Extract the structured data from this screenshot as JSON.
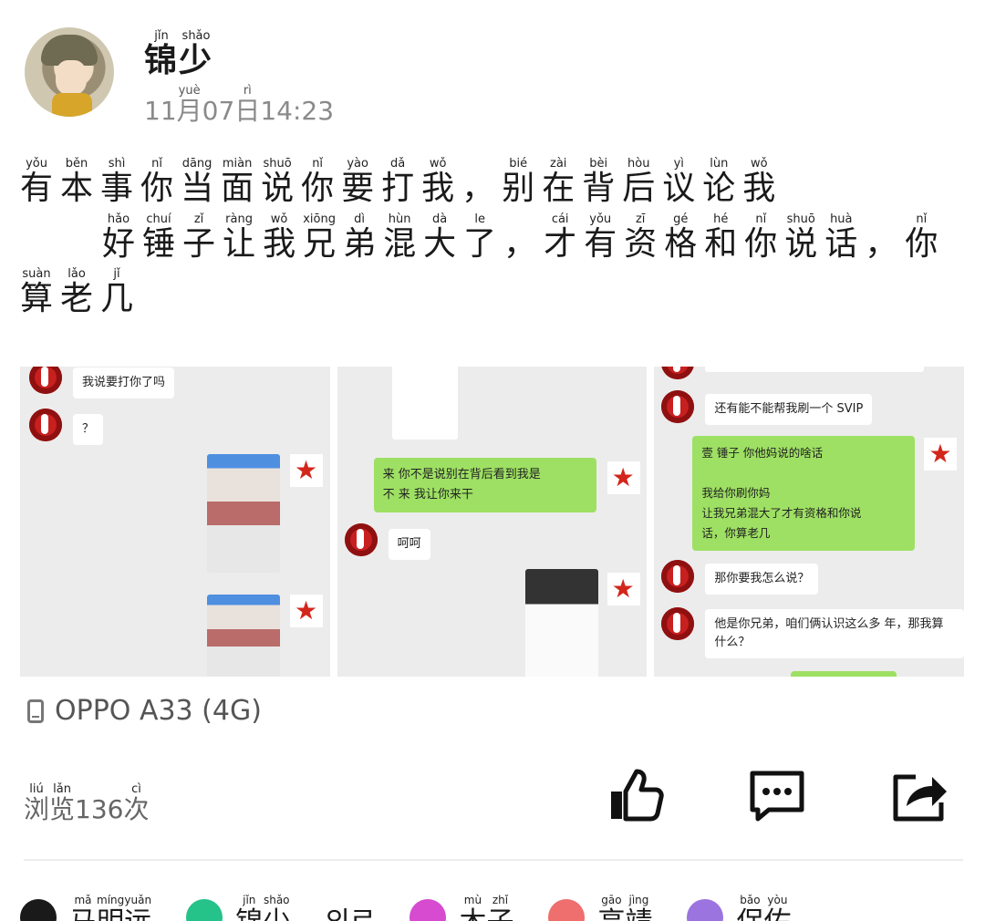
{
  "author": {
    "chars": [
      {
        "py": "jǐn",
        "hz": "锦"
      },
      {
        "py": "shǎo",
        "hz": "少"
      }
    ]
  },
  "post_time": {
    "chars": [
      {
        "py": "",
        "hz": "11"
      },
      {
        "py": "yuè",
        "hz": "月"
      },
      {
        "py": "",
        "hz": "07"
      },
      {
        "py": "rì",
        "hz": "日"
      },
      {
        "py": "",
        "hz": "14:23"
      }
    ]
  },
  "post_text": {
    "line1": [
      {
        "py": "yǒu",
        "hz": "有"
      },
      {
        "py": "běn",
        "hz": "本"
      },
      {
        "py": "shì",
        "hz": "事"
      },
      {
        "py": "nǐ",
        "hz": "你"
      },
      {
        "py": "dāng",
        "hz": "当"
      },
      {
        "py": "miàn",
        "hz": "面"
      },
      {
        "py": "shuō",
        "hz": "说"
      },
      {
        "py": "nǐ",
        "hz": "你"
      },
      {
        "py": "yào",
        "hz": "要"
      },
      {
        "py": "dǎ",
        "hz": "打"
      },
      {
        "py": "wǒ",
        "hz": "我"
      },
      {
        "py": "",
        "hz": "，"
      },
      {
        "py": "bié",
        "hz": "别"
      },
      {
        "py": "zài",
        "hz": "在"
      },
      {
        "py": "bèi",
        "hz": "背"
      },
      {
        "py": "hòu",
        "hz": "后"
      },
      {
        "py": "yì",
        "hz": "议"
      },
      {
        "py": "lùn",
        "hz": "论"
      },
      {
        "py": "wǒ",
        "hz": "我"
      }
    ],
    "line2": [
      {
        "py": "hǎo",
        "hz": "好"
      },
      {
        "py": "chuí",
        "hz": "锤"
      },
      {
        "py": "zǐ",
        "hz": "子"
      },
      {
        "py": "ràng",
        "hz": "让"
      },
      {
        "py": "wǒ",
        "hz": "我"
      },
      {
        "py": "xiōng",
        "hz": "兄"
      },
      {
        "py": "dì",
        "hz": "弟"
      },
      {
        "py": "hùn",
        "hz": "混"
      },
      {
        "py": "dà",
        "hz": "大"
      },
      {
        "py": "le",
        "hz": "了"
      },
      {
        "py": "",
        "hz": "，"
      },
      {
        "py": "cái",
        "hz": "才"
      },
      {
        "py": "yǒu",
        "hz": "有"
      },
      {
        "py": "zī",
        "hz": "资"
      },
      {
        "py": "gé",
        "hz": "格"
      },
      {
        "py": "hé",
        "hz": "和"
      },
      {
        "py": "nǐ",
        "hz": "你"
      },
      {
        "py": "shuō",
        "hz": "说"
      },
      {
        "py": "huà",
        "hz": "话"
      },
      {
        "py": "",
        "hz": "，"
      },
      {
        "py": "nǐ",
        "hz": "你"
      }
    ],
    "line3": [
      {
        "py": "suàn",
        "hz": "算"
      },
      {
        "py": "lǎo",
        "hz": "老"
      },
      {
        "py": "jǐ",
        "hz": "几"
      }
    ]
  },
  "screenshots": {
    "s1": {
      "m1": "我说要打你了吗",
      "m2": "？"
    },
    "s2": {
      "m1": "来      你不是说别在背后看到我是\n不      来   我让你来干",
      "m2": "呵呵"
    },
    "s3": {
      "m1": "还有能不能帮我刷一个 SVIP",
      "m2": "壹    锤子   你他妈说的啥话\n\n我给你刷你妈\n    让我兄弟混大了才有资格和你说\n话，你算老几",
      "m3": "那你要我怎么说？",
      "m4": "他是你兄弟，咱们俩认识这么多\n年，那我算什么？"
    }
  },
  "device": {
    "label": "OPPO A33 (4G)"
  },
  "views": {
    "chars": [
      {
        "py": "liú",
        "hz": "浏"
      },
      {
        "py": "lǎn",
        "hz": "览"
      }
    ],
    "count": "136",
    "unit": [
      {
        "py": "cì",
        "hz": "次"
      }
    ]
  },
  "reactions": [
    {
      "color": "#1a1a1a",
      "icon": "thumbs-up-small-icon",
      "chars": [
        {
          "py": "mǎ",
          "hz": "马"
        },
        {
          "py": "míng",
          "hz": "明"
        },
        {
          "py": "yuǎn",
          "hz": "远"
        }
      ]
    },
    {
      "color": "#25c28a",
      "icon": "green-avatar-icon",
      "chars": [
        {
          "py": "jǐn",
          "hz": "锦"
        },
        {
          "py": "shǎo",
          "hz": "少"
        }
      ]
    },
    {
      "color": "#ffffff",
      "icon": "",
      "chars": [
        {
          "py": "",
          "hz": "외르"
        }
      ]
    },
    {
      "color": "#d64bd0",
      "icon": "purple-avatar-icon",
      "chars": [
        {
          "py": "mù",
          "hz": "木"
        },
        {
          "py": "zhǐ",
          "hz": "子"
        }
      ]
    },
    {
      "color": "#ef6e6e",
      "icon": "red-avatar-icon",
      "chars": [
        {
          "py": "gāo",
          "hz": "高"
        },
        {
          "py": "jìng",
          "hz": "靖"
        }
      ]
    },
    {
      "color": "#9b74e0",
      "icon": "violet-avatar-icon",
      "chars": [
        {
          "py": "bǎo",
          "hz": "保"
        },
        {
          "py": "yòu",
          "hz": "佑"
        }
      ]
    }
  ]
}
